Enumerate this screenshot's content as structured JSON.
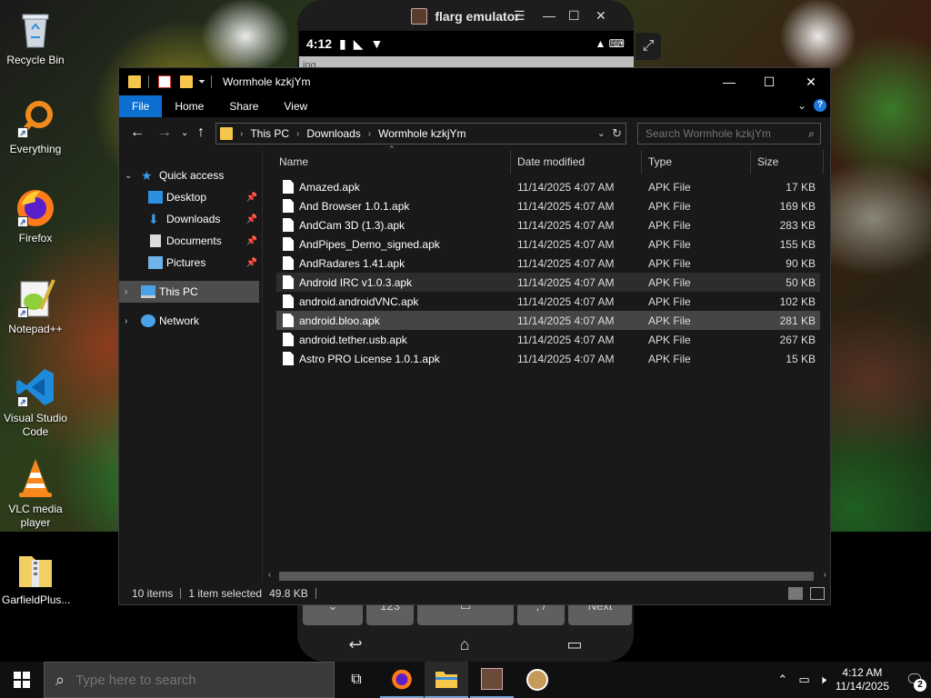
{
  "desktop": {
    "icons": [
      {
        "label": "Recycle Bin",
        "icon": "recycle-bin-icon"
      },
      {
        "label": "Everything",
        "icon": "everything-search-icon"
      },
      {
        "label": "Firefox",
        "icon": "firefox-icon"
      },
      {
        "label": "Notepad++",
        "icon": "notepad-plus-plus-icon"
      },
      {
        "label": "Visual Studio Code",
        "icon": "vscode-icon"
      },
      {
        "label": "VLC media player",
        "icon": "vlc-icon"
      },
      {
        "label": "GarfieldPlus...",
        "icon": "folder-zip-icon"
      }
    ]
  },
  "emulator": {
    "title": "flarg emulator",
    "status_time": "4:12",
    "partial_text": "ing",
    "keys": [
      "",
      "123",
      "",
      ", /",
      "Next"
    ]
  },
  "explorer": {
    "title": "Wormhole kzkjYm",
    "ribbon_tabs": [
      "File",
      "Home",
      "Share",
      "View"
    ],
    "breadcrumb": [
      "This PC",
      "Downloads",
      "Wormhole kzkjYm"
    ],
    "search_placeholder": "Search Wormhole kzkjYm",
    "nav": {
      "quick_access": "Quick access",
      "desktop": "Desktop",
      "downloads": "Downloads",
      "documents": "Documents",
      "pictures": "Pictures",
      "this_pc": "This PC",
      "network": "Network"
    },
    "columns": {
      "name": "Name",
      "date": "Date modified",
      "type": "Type",
      "size": "Size"
    },
    "files": [
      {
        "name": "Amazed.apk",
        "date": "11/14/2025 4:07 AM",
        "type": "APK File",
        "size": "17 KB"
      },
      {
        "name": "And Browser 1.0.1.apk",
        "date": "11/14/2025 4:07 AM",
        "type": "APK File",
        "size": "169 KB"
      },
      {
        "name": "AndCam 3D (1.3).apk",
        "date": "11/14/2025 4:07 AM",
        "type": "APK File",
        "size": "283 KB"
      },
      {
        "name": "AndPipes_Demo_signed.apk",
        "date": "11/14/2025 4:07 AM",
        "type": "APK File",
        "size": "155 KB"
      },
      {
        "name": "AndRadares 1.41.apk",
        "date": "11/14/2025 4:07 AM",
        "type": "APK File",
        "size": "90 KB"
      },
      {
        "name": "Android IRC v1.0.3.apk",
        "date": "11/14/2025 4:07 AM",
        "type": "APK File",
        "size": "50 KB"
      },
      {
        "name": "android.androidVNC.apk",
        "date": "11/14/2025 4:07 AM",
        "type": "APK File",
        "size": "102 KB"
      },
      {
        "name": "android.bloo.apk",
        "date": "11/14/2025 4:07 AM",
        "type": "APK File",
        "size": "281 KB"
      },
      {
        "name": "android.tether.usb.apk",
        "date": "11/14/2025 4:07 AM",
        "type": "APK File",
        "size": "267 KB"
      },
      {
        "name": "Astro PRO License 1.0.1.apk",
        "date": "11/14/2025 4:07 AM",
        "type": "APK File",
        "size": "15 KB"
      }
    ],
    "status": {
      "count": "10 items",
      "selected": "1 item selected",
      "size": "49.8 KB"
    }
  },
  "taskbar": {
    "search_placeholder": "Type here to search",
    "time": "4:12 AM",
    "date": "11/14/2025",
    "notification_count": "2"
  },
  "colors": {
    "accent": "#0c6fd0",
    "folder": "#f5c74a",
    "selection": "#454545"
  }
}
